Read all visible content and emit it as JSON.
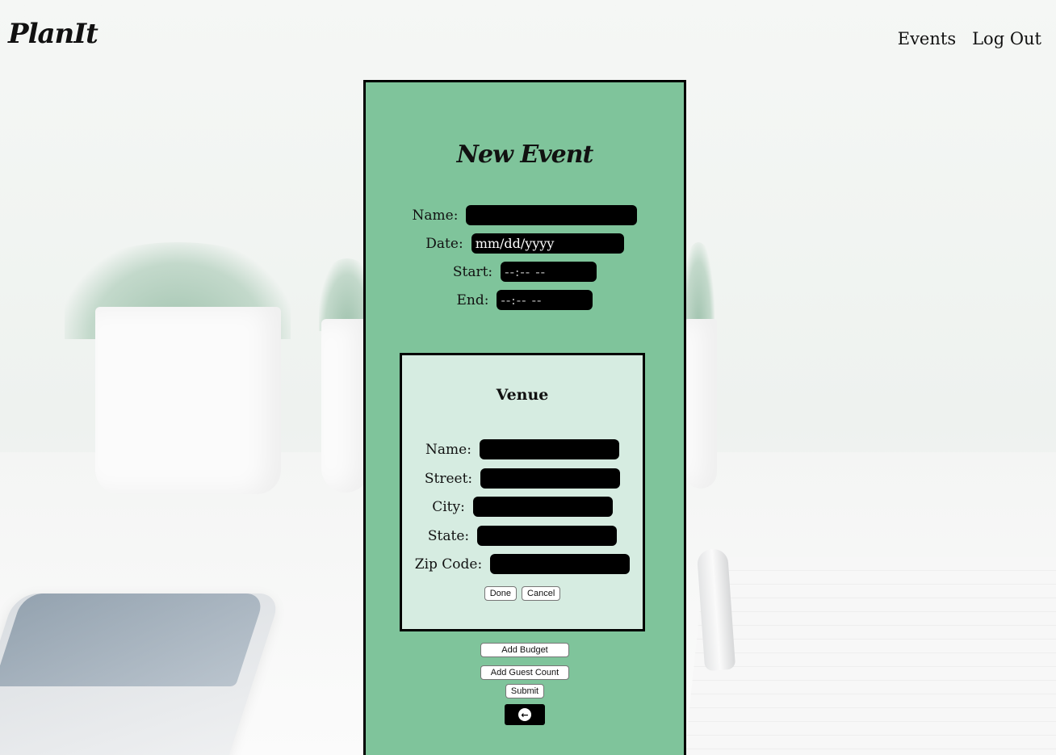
{
  "header": {
    "logo": "PlanIt",
    "nav": {
      "events": "Events",
      "logout": "Log Out"
    }
  },
  "form": {
    "title": "New Event",
    "fields": {
      "name": {
        "label": "Name:",
        "value": ""
      },
      "date": {
        "label": "Date:",
        "value": "mm/dd/yyyy"
      },
      "start": {
        "label": "Start:",
        "value": "--:-- --"
      },
      "end": {
        "label": "End:",
        "value": "--:-- --"
      }
    },
    "venue": {
      "title": "Venue",
      "fields": {
        "name": {
          "label": "Name:",
          "value": ""
        },
        "street": {
          "label": "Street:",
          "value": ""
        },
        "city": {
          "label": "City:",
          "value": ""
        },
        "state": {
          "label": "State:",
          "value": ""
        },
        "zip": {
          "label": "Zip Code:",
          "value": ""
        }
      },
      "done_label": "Done",
      "cancel_label": "Cancel"
    },
    "add_budget_label": "Add Budget",
    "add_guest_count_label": "Add Guest Count",
    "submit_label": "Submit",
    "back_icon": "arrow-left-circle-icon"
  },
  "colors": {
    "panel": "#7fc49b",
    "venue_box": "#d6ece1",
    "input_bg": "#000000"
  }
}
